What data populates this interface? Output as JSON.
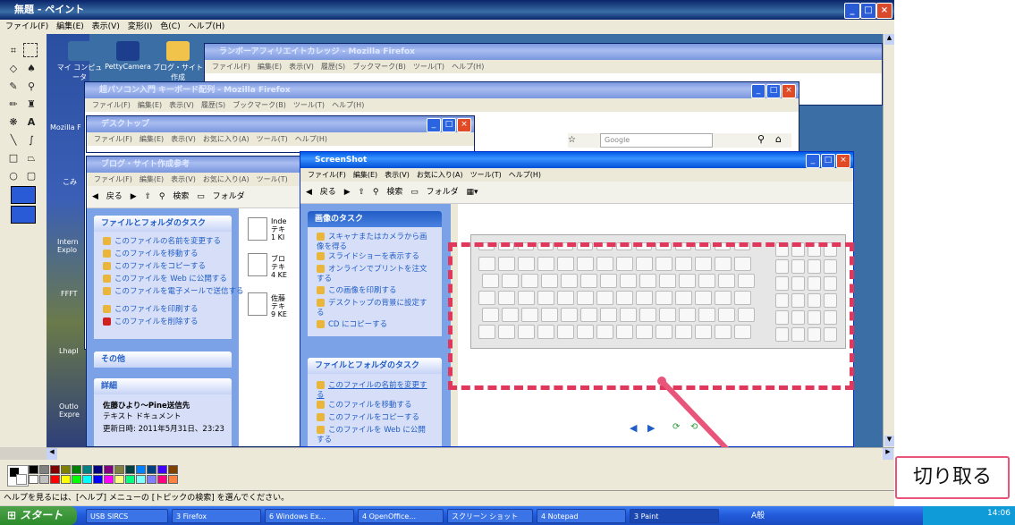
{
  "paint": {
    "title": "無題 - ペイント",
    "menu": [
      "ファイル(F)",
      "編集(E)",
      "表示(V)",
      "変形(I)",
      "色(C)",
      "ヘルプ(H)"
    ],
    "status": "ヘルプを見るには、[ヘルプ] メニューの [トピックの検索] を選んでください。",
    "palette_colors": [
      "#000000",
      "#808080",
      "#800000",
      "#808000",
      "#008000",
      "#008080",
      "#000080",
      "#800080",
      "#808040",
      "#004040",
      "#0080ff",
      "#004080",
      "#4000ff",
      "#804000",
      "#ffffff",
      "#c0c0c0",
      "#ff0000",
      "#ffff00",
      "#00ff00",
      "#00ffff",
      "#0000ff",
      "#ff00ff",
      "#ffff80",
      "#00ff80",
      "#80ffff",
      "#8080ff",
      "#ff0080",
      "#ff8040"
    ]
  },
  "desktop_icons": [
    "マイ コンピュータ",
    "PettyCamera",
    "ブログ・サイト作成"
  ],
  "desktop_side_labels": [
    "Mozilla F",
    "こみ",
    "Intern Explo",
    "FFFT",
    "Lhapl",
    "Outlo Expre"
  ],
  "windows": {
    "firefox1": {
      "title": "ランボーアフィリエイトカレッジ - Mozilla Firefox",
      "menu": [
        "ファイル(F)",
        "編集(E)",
        "表示(V)",
        "履歴(S)",
        "ブックマーク(B)",
        "ツール(T)",
        "ヘルプ(H)"
      ]
    },
    "firefox2": {
      "title": "超パソコン入門 キーボード配列 - Mozilla Firefox",
      "menu": [
        "ファイル(F)",
        "編集(E)",
        "表示(V)",
        "履歴(S)",
        "ブックマーク(B)",
        "ツール(T)",
        "ヘルプ(H)"
      ],
      "search_placeholder": "Google"
    },
    "desktop": {
      "title": "デスクトップ",
      "menu": [
        "ファイル(F)",
        "編集(E)",
        "表示(V)",
        "お気に入り(A)",
        "ツール(T)",
        "ヘルプ(H)"
      ]
    },
    "blog": {
      "title": "ブログ・サイト作成参考",
      "menu": [
        "ファイル(F)",
        "編集(E)",
        "表示(V)",
        "お気に入り(A)",
        "ツール(T)"
      ],
      "toolbar": {
        "back": "戻る",
        "search": "検索",
        "folder": "フォルダ"
      },
      "file_tasks_title": "ファイルとフォルダのタスク",
      "file_tasks": [
        "このファイルの名前を変更する",
        "このファイルを移動する",
        "このファイルをコピーする",
        "このファイルを Web に公開する",
        "このファイルを電子メールで送信する",
        "このファイルを印刷する",
        "このファイルを削除する"
      ],
      "other_title": "その他",
      "details_title": "詳細",
      "detail_name": "佐藤ひより～Pine送信先",
      "detail_type": "テキスト ドキュメント",
      "detail_date": "更新日時: 2011年5月31日、23:23",
      "files": [
        {
          "name": "Inde",
          "sub": "テキ",
          "size": "1 KI"
        },
        {
          "name": "ブロ",
          "sub": "テキ",
          "size": "4 KE"
        },
        {
          "name": "佐藤",
          "sub": "テキ",
          "size": "9 KE"
        }
      ]
    },
    "screenshot": {
      "title": "ScreenShot",
      "menu": [
        "ファイル(F)",
        "編集(E)",
        "表示(V)",
        "お気に入り(A)",
        "ツール(T)",
        "ヘルプ(H)"
      ],
      "toolbar": {
        "back": "戻る",
        "search": "検索",
        "folder": "フォルダ"
      },
      "image_tasks_title": "画像のタスク",
      "image_tasks": [
        "スキャナまたはカメラから画像を得る",
        "スライドショーを表示する",
        "オンラインでプリントを注文する",
        "この画像を印刷する",
        "デスクトップの背景に設定する",
        "CD にコピーする"
      ],
      "file_tasks_title": "ファイルとフォルダのタスク",
      "file_tasks": [
        "このファイルの名前を変更する",
        "このファイルを移動する",
        "このファイルをコピーする",
        "このファイルを Web に公開する"
      ]
    }
  },
  "taskbar": {
    "start": "スタート",
    "items": [
      "USB SIRCS",
      "3 Firefox",
      "6 Windows Ex...",
      "4 OpenOffice...",
      "スクリーン ショット",
      "4 Notepad",
      "3 Paint"
    ],
    "ime": "A般",
    "clock": "14:06"
  },
  "callout": "切り取る",
  "colors": {
    "accent": "#e0385c",
    "xp_title": "#0058e6",
    "task_pane": "#7ba2e7"
  }
}
